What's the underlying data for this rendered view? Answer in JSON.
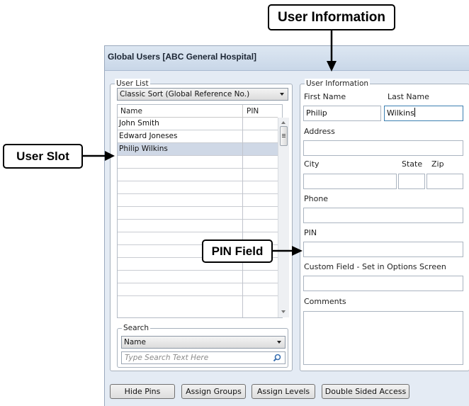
{
  "annotations": {
    "user_information": "User Information",
    "user_slot": "User Slot",
    "pin_field": "PIN Field"
  },
  "window": {
    "title": "Global Users [ABC General Hospital]"
  },
  "user_list": {
    "legend": "User List",
    "sort_selected": "Classic Sort (Global Reference No.)",
    "columns": [
      "Name",
      "PIN"
    ],
    "users": [
      {
        "name": "John Smith",
        "pin": ""
      },
      {
        "name": "Edward Joneses",
        "pin": ""
      },
      {
        "name": "Philip Wilkins",
        "pin": ""
      }
    ],
    "selected_index": 2,
    "empty_rows": 11
  },
  "search": {
    "legend": "Search",
    "field_selected": "Name",
    "placeholder": "Type Search Text Here"
  },
  "user_info": {
    "legend": "User Information",
    "first_name_label": "First Name",
    "last_name_label": "Last Name",
    "first_name_value": "Philip",
    "last_name_value": "Wilkins",
    "address_label": "Address",
    "address_value": "",
    "city_label": "City",
    "state_label": "State",
    "zip_label": "Zip",
    "phone_label": "Phone",
    "pin_label": "PIN",
    "custom_label": "Custom Field - Set in Options Screen",
    "comments_label": "Comments"
  },
  "buttons": {
    "hide_pins": "Hide Pins",
    "assign_groups": "Assign Groups",
    "assign_levels": "Assign Levels",
    "double_sided": "Double Sided Access"
  },
  "colors": {
    "window_bg": "#e4ebf4",
    "selected_row": "#cfd8e6",
    "focus_border": "#3c7fb1"
  }
}
